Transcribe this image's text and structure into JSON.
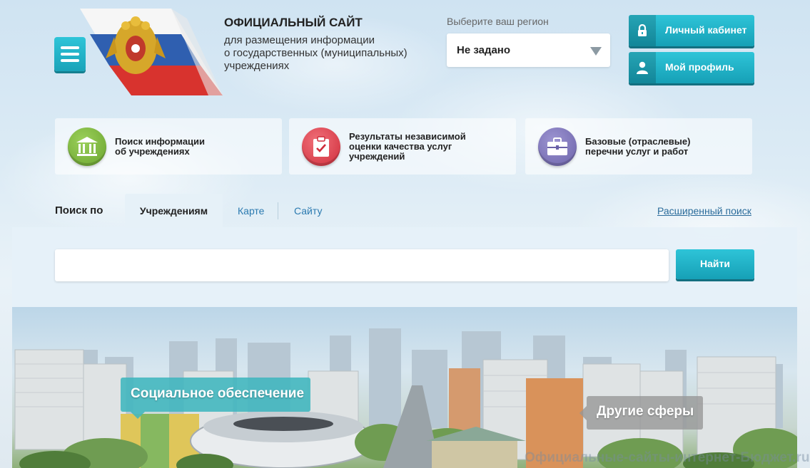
{
  "header": {
    "title": "ОФИЦИАЛЬНЫЙ САЙТ",
    "subtitle_lines": [
      "для размещения информации",
      "о государственных (муниципальных)",
      "учреждениях"
    ],
    "menu_icon": "hamburger-icon",
    "emblem_icon": "coat-of-arms-icon"
  },
  "region": {
    "label": "Выберите ваш регион",
    "selected": "Не задано"
  },
  "top_buttons": {
    "cabinet": {
      "label": "Личный кабинет",
      "icon": "lock-icon"
    },
    "profile": {
      "label": "Мой профиль",
      "icon": "user-icon"
    }
  },
  "cards": [
    {
      "lines": [
        "Поиск информации",
        "об учреждениях"
      ],
      "icon": "institution-icon",
      "color": "#7ab53a"
    },
    {
      "lines": [
        "Результаты независимой",
        "оценки качества услуг",
        "учреждений"
      ],
      "icon": "clipboard-check-icon",
      "color": "#e0424f"
    },
    {
      "lines": [
        "Базовые (отраслевые)",
        "перечни услуг и работ"
      ],
      "icon": "briefcase-icon",
      "color": "#7a71b6"
    }
  ],
  "search": {
    "label": "Поиск по",
    "tabs": [
      "Учреждениям",
      "Карте",
      "Сайту"
    ],
    "active_tab": "Учреждениям",
    "advanced_link": "Расширенный поиск",
    "input_value": "",
    "input_placeholder": "",
    "button_label": "Найти"
  },
  "banner": {
    "social": "Социальное обеспечение",
    "other": "Другие сферы"
  },
  "watermark": "Официальные-сайты-интернет-Бюджет.ru",
  "colors": {
    "accent": "#1fb1c7",
    "link": "#2b7ab0"
  }
}
